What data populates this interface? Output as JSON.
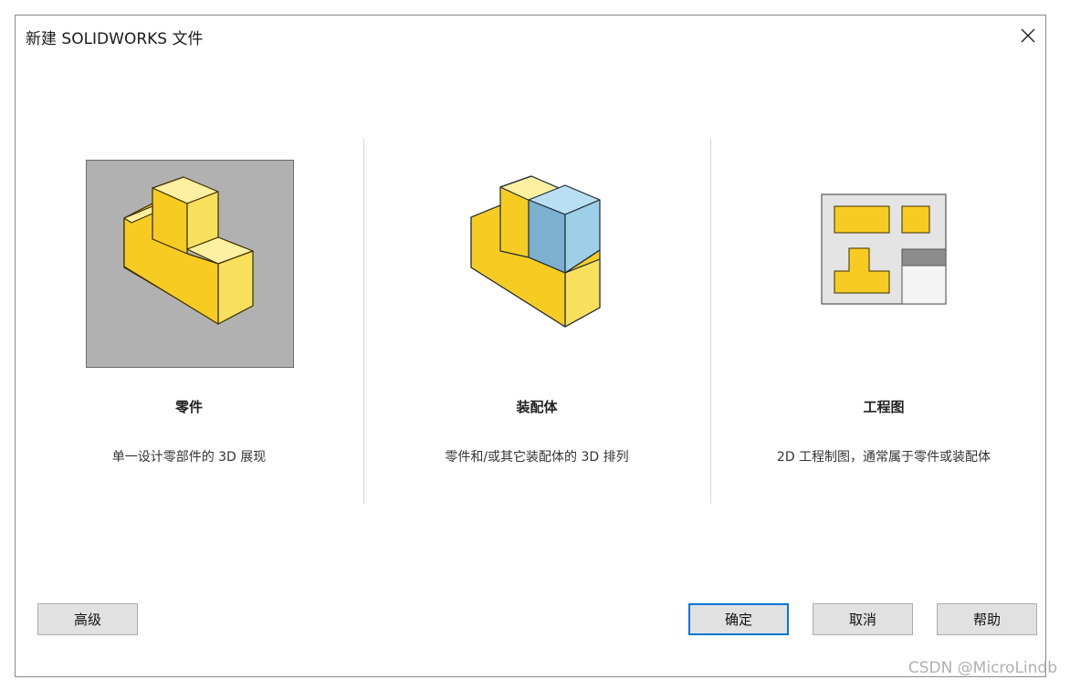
{
  "window": {
    "title": "新建 SOLIDWORKS 文件",
    "close_icon": "close-icon"
  },
  "options": [
    {
      "id": "part",
      "title": "零件",
      "description": "单一设计零部件的 3D 展现",
      "selected": true,
      "icon": "part-3d-icon"
    },
    {
      "id": "assembly",
      "title": "装配体",
      "description": "零件和/或其它装配体的 3D 排列",
      "selected": false,
      "icon": "assembly-3d-icon"
    },
    {
      "id": "drawing",
      "title": "工程图",
      "description": "2D 工程制图，通常属于零件或装配体",
      "selected": false,
      "icon": "drawing-2d-icon"
    }
  ],
  "buttons": {
    "advanced": "高级",
    "ok": "确定",
    "cancel": "取消",
    "help": "帮助"
  },
  "watermark": "CSDN @MicroLindb",
  "colors": {
    "part_yellow": "#f7cc22",
    "part_top": "#fdf0a0",
    "part_side": "#f9e05c",
    "assembly_blue": "#9dcfe8",
    "selection_bg": "#b1b1b1",
    "primary_border": "#0078d7"
  }
}
